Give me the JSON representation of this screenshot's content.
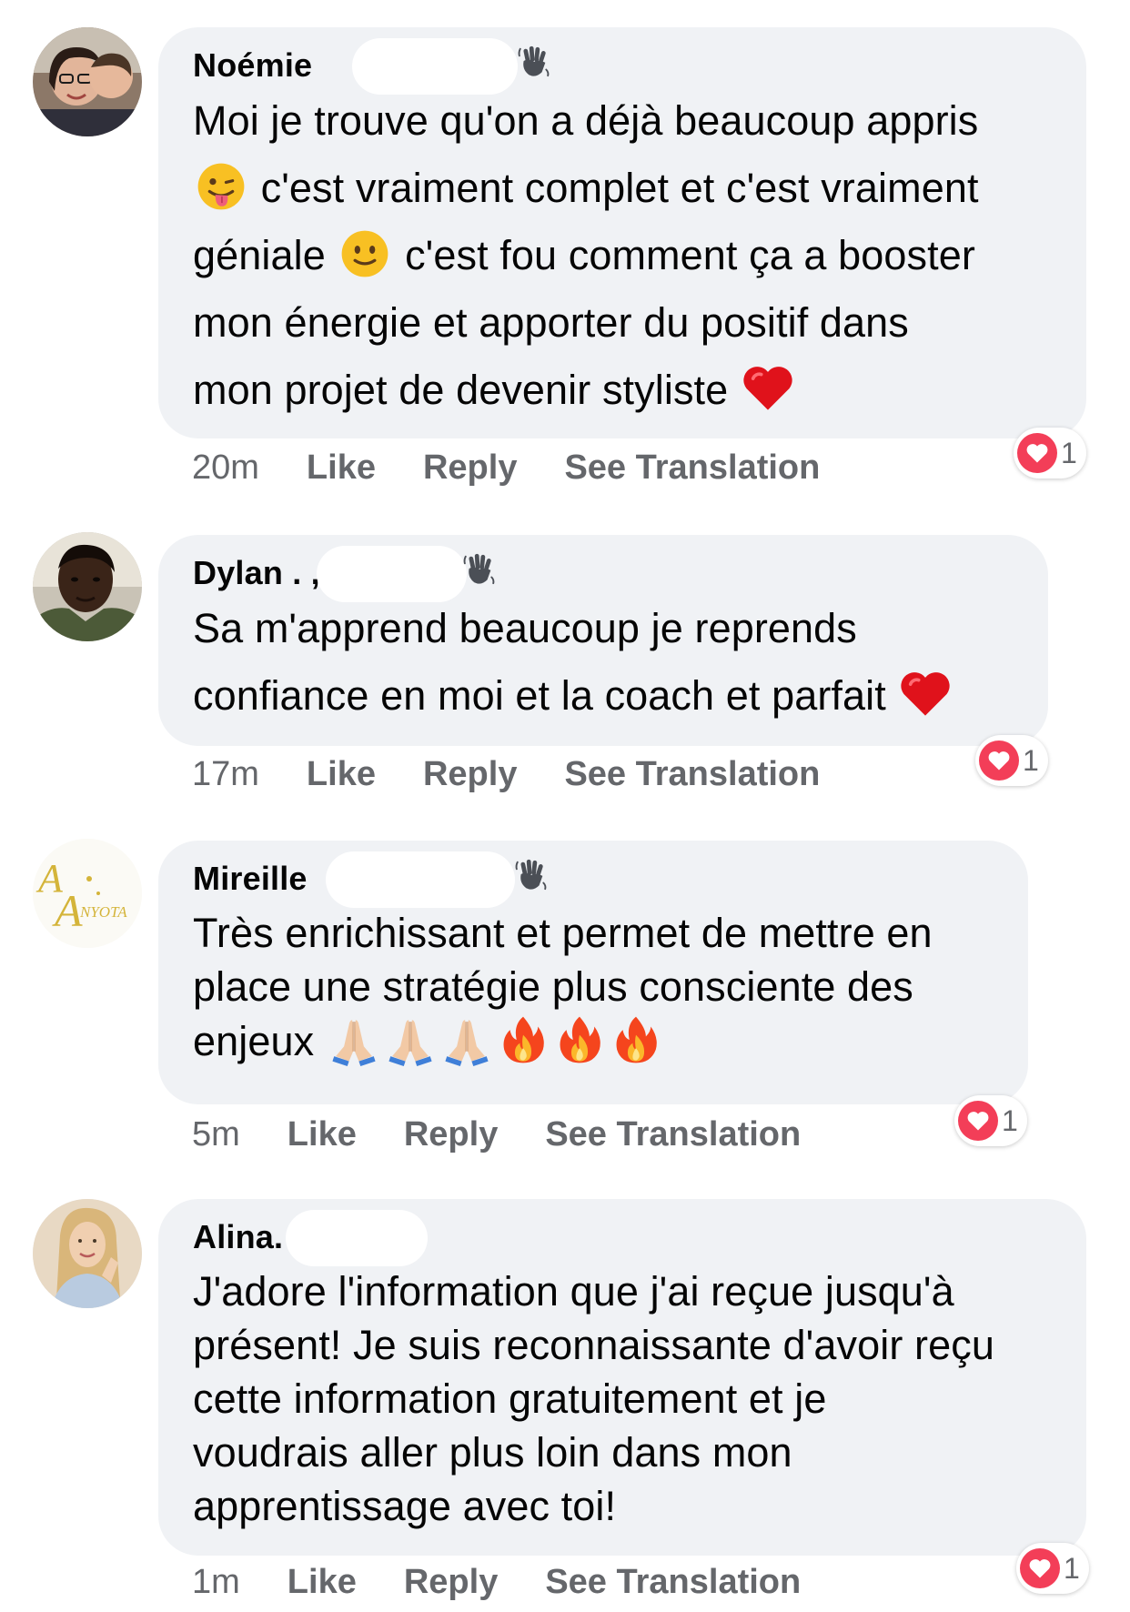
{
  "comments": [
    {
      "author": "Noémie",
      "text_parts": [
        "Moi je trouve qu'on a déjà beaucoup appris",
        "c'est vraiment complet et c'est vraiment",
        "géniale",
        "c'est fou comment ça a booster",
        "mon énergie et apporter du positif dans",
        "mon projet de devenir styliste"
      ],
      "emojis": [
        "tongue-face-emoji",
        "slight-smile-emoji",
        "red-heart-emoji"
      ],
      "time": "20m",
      "reaction_count": "1"
    },
    {
      "author": "Dylan . ,",
      "text_parts": [
        "Sa m'apprend beaucoup je reprends",
        "confiance en moi et la coach et parfait"
      ],
      "emojis": [
        "red-heart-emoji"
      ],
      "time": "17m",
      "reaction_count": "1"
    },
    {
      "author": "Mireille",
      "text_parts": [
        "Très enrichissant et permet de mettre en",
        "place une stratégie plus consciente des",
        "enjeux"
      ],
      "emojis": [
        "folded-hands-emoji",
        "folded-hands-emoji",
        "folded-hands-emoji",
        "fire-emoji",
        "fire-emoji",
        "fire-emoji"
      ],
      "time": "5m",
      "reaction_count": "1"
    },
    {
      "author": "Alina.",
      "text_parts": [
        "J'adore l'information que j'ai reçue jusqu'à",
        "présent! Je suis reconnaissante d'avoir reçu",
        "cette information gratuitement et je",
        "voudrais aller plus loin dans mon",
        "apprentissage avec toi!"
      ],
      "emojis": [],
      "time": "1m",
      "reaction_count": "1"
    }
  ],
  "actions": {
    "like": "Like",
    "reply": "Reply",
    "see_translation": "See Translation"
  },
  "avatar_3_logo_text": "AA ANYOTA",
  "colors": {
    "bubble": "#f0f2f5",
    "meta_text": "#65676b",
    "heart_reaction": "#f33e58",
    "body_text": "#050505"
  },
  "icons": {
    "wave": "waving-hand-icon",
    "reaction": "heart-reaction-icon"
  }
}
